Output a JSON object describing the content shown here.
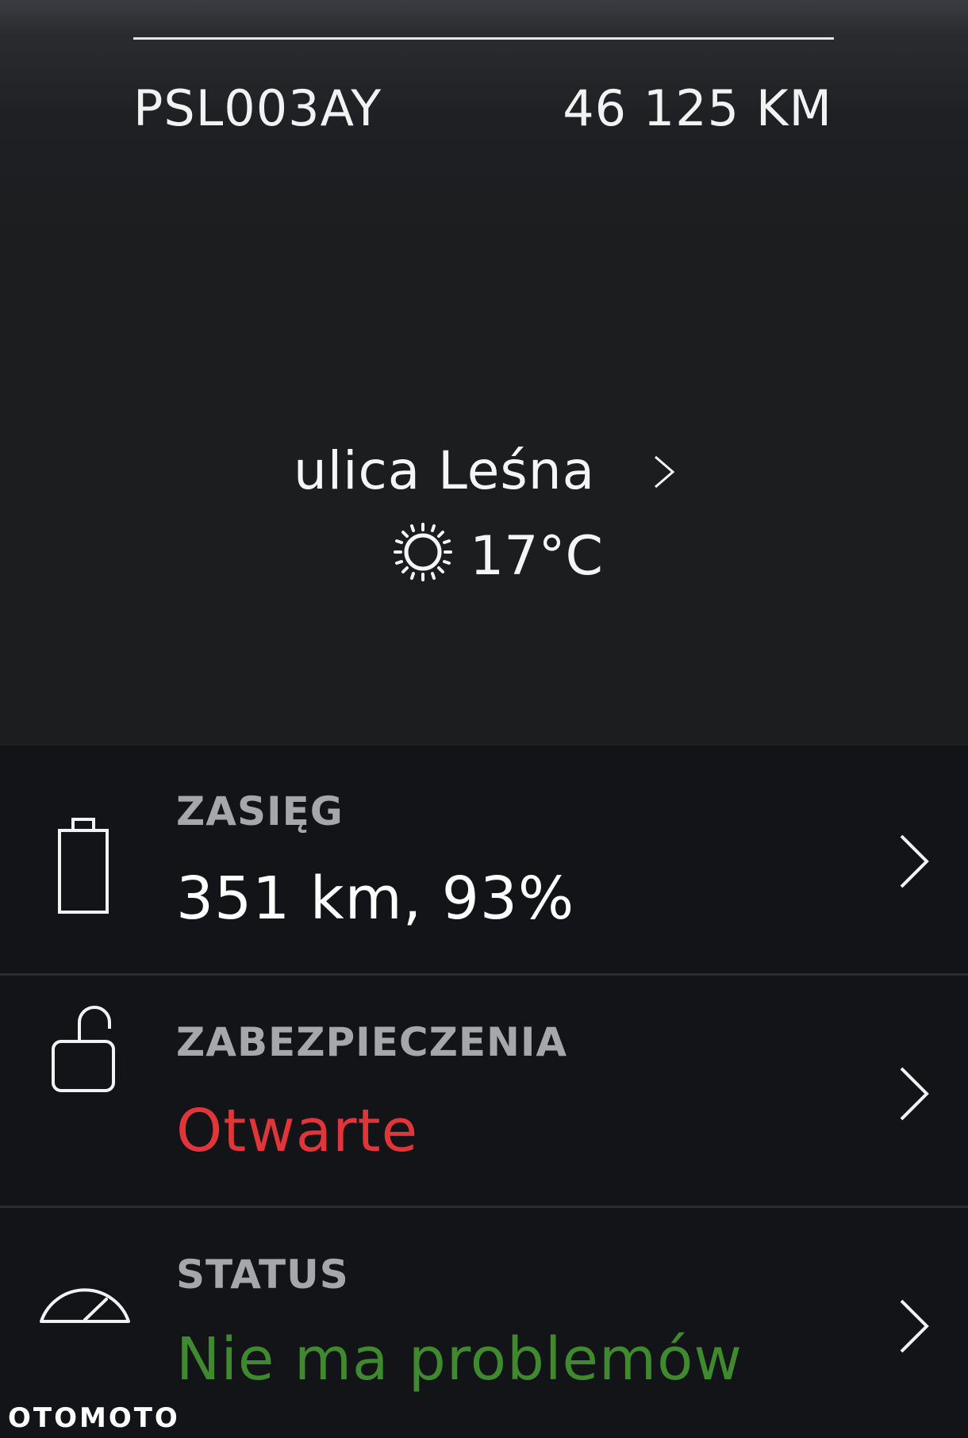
{
  "vehicle": {
    "plate": "PSL003AY",
    "odometer": "46 125 KM"
  },
  "location": {
    "street": "ulica Leśna",
    "temperature": "17°C",
    "weather_icon": "sun-icon"
  },
  "cards": [
    {
      "label": "ZASIĘG",
      "value": "351 km, 93%",
      "icon": "battery-icon",
      "value_color": "#ffffff"
    },
    {
      "label": "ZABEZPIECZENIA",
      "value": "Otwarte",
      "icon": "unlocked-padlock-icon",
      "value_color": "#e0363a"
    },
    {
      "label": "STATUS",
      "value": "Nie ma problemów",
      "icon": "speedometer-icon",
      "value_color": "#3f8a2e"
    }
  ],
  "watermark": "OTOMOTO",
  "colors": {
    "background": "#1c1d1f",
    "card_background": "#131417",
    "label": "#a6a7ab",
    "alert_red": "#e0363a",
    "ok_green": "#3f8a2e"
  }
}
